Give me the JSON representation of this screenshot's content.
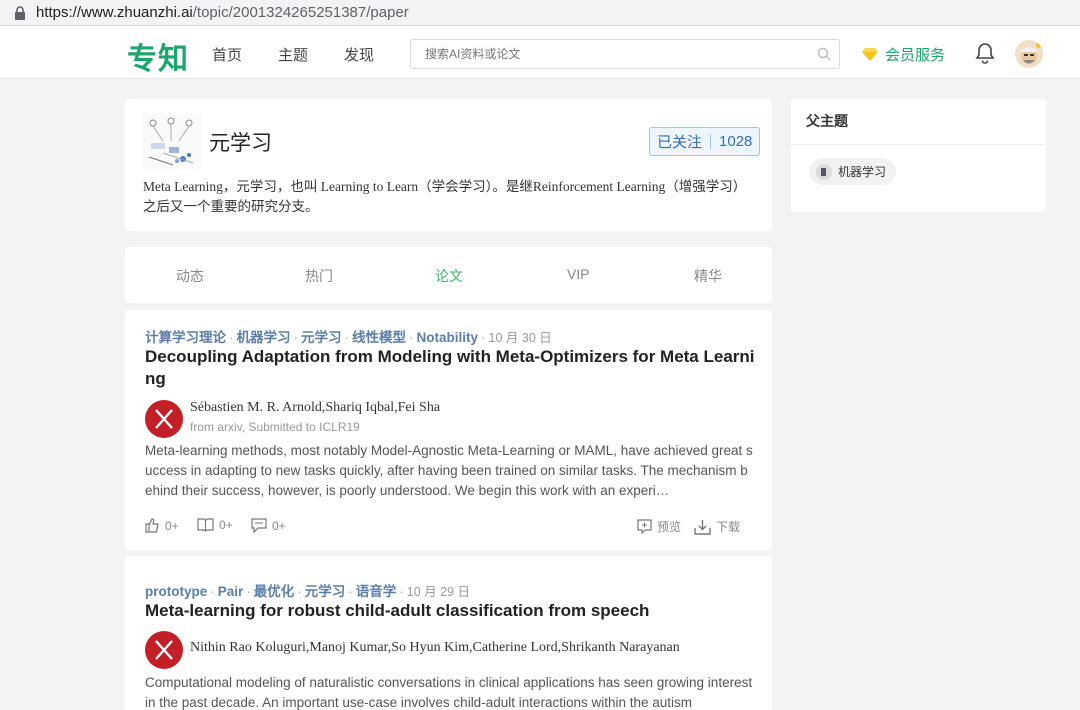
{
  "browser": {
    "url_host": "https://www.zhuanzhi.ai",
    "url_path": "/topic/2001324265251387/paper"
  },
  "nav": {
    "logo": "专知",
    "links": [
      "首页",
      "主题",
      "发现"
    ],
    "search_placeholder": "搜索AI资料或论文",
    "member_service": "会员服务"
  },
  "topic": {
    "title": "元学习",
    "follow_label": "已关注",
    "follow_count": "1028",
    "description": "Meta Learning，元学习，也叫 Learning to Learn（学会学习）。是继Reinforcement Learning（增强学习）之后又一个重要的研究分支。"
  },
  "tabs": [
    "动态",
    "热门",
    "论文",
    "VIP",
    "精华"
  ],
  "active_tab": "论文",
  "parent_topics": {
    "heading": "父主题",
    "items": [
      "机器学习"
    ]
  },
  "papers": [
    {
      "tags": [
        "计算学习理论",
        "机器学习",
        "元学习",
        "线性模型",
        "Notability"
      ],
      "date": "10 月 30 日",
      "title": "Decoupling Adaptation from Modeling with Meta-Optimizers for Meta Learning",
      "authors": "Sébastien M. R. Arnold,Shariq Iqbal,Fei Sha",
      "source": "from arxiv, Submitted to ICLR19",
      "abstract": "Meta-learning methods, most notably Model-Agnostic Meta-Learning or MAML, have achieved great success in adapting to new tasks quickly, after having been trained on similar tasks. The mechanism behind their success, however, is poorly understood. We begin this work with an experi…",
      "likes": "0+",
      "notes": "0+",
      "comments": "0+",
      "preview_label": "预览",
      "download_label": "下载"
    },
    {
      "tags": [
        "prototype",
        "Pair",
        "最优化",
        "元学习",
        "语音学"
      ],
      "date": "10 月 29 日",
      "title": "Meta-learning for robust child-adult classification from speech",
      "authors": "Nithin Rao Koluguri,Manoj Kumar,So Hyun Kim,Catherine Lord,Shrikanth Narayanan",
      "abstract": "Computational modeling of naturalistic conversations in clinical applications has seen growing interest in the past decade. An important use-case involves child-adult interactions within the autism"
    }
  ],
  "colors": {
    "brand": "#1aa66c",
    "tag": "#5a7fa8",
    "active_tab": "#3cb371",
    "author_avatar": "#c21f27"
  }
}
